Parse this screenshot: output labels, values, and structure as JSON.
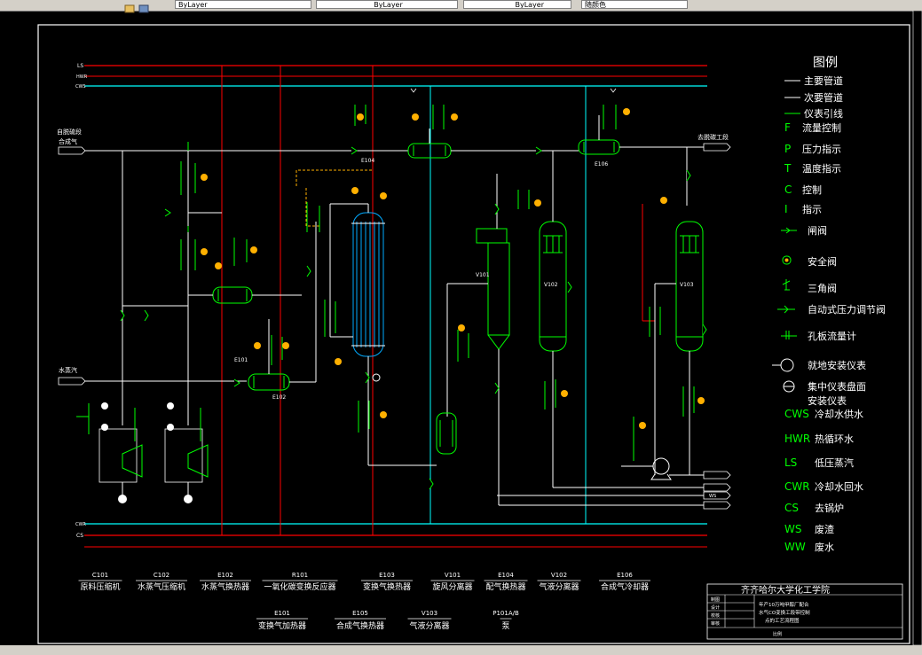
{
  "toolbar": {
    "layer_color": "ByLayer",
    "linetype": "ByLayer",
    "lineweight": "ByLayer",
    "plot_style": "随颜色"
  },
  "drawing": {
    "pipe_labels": {
      "ls": "LS",
      "hwr": "HWR",
      "cws": "CWS",
      "cwr": "CWR",
      "cs": "CS"
    },
    "inlets": {
      "from_desulfur": "自脱硫段",
      "syngas": "合成气",
      "steam": "水蒸汽"
    },
    "outlet": "去脱碳工段",
    "ws_outlet": "WS",
    "equipment_tags": {
      "E104": "E104",
      "E106": "E106",
      "E101": "E101",
      "E102": "E102",
      "V101": "V101",
      "V102": "V102",
      "V103": "V103"
    },
    "equipment_list_row1": [
      {
        "tag": "C101",
        "name": "原料压缩机"
      },
      {
        "tag": "C102",
        "name": "水蒸气压缩机"
      },
      {
        "tag": "E102",
        "name": "水蒸气换热器"
      },
      {
        "tag": "R101",
        "name": "一氧化碳变换反应器"
      },
      {
        "tag": "E103",
        "name": "变换气换热器"
      },
      {
        "tag": "V101",
        "name": "旋风分离器"
      },
      {
        "tag": "E104",
        "name": "配气换热器"
      },
      {
        "tag": "V102",
        "name": "气液分离器"
      },
      {
        "tag": "E106",
        "name": "合成气冷却器"
      }
    ],
    "equipment_list_row2": [
      {
        "tag": "E101",
        "name": "变换气加热器"
      },
      {
        "tag": "E105",
        "name": "合成气换热器"
      },
      {
        "tag": "V103",
        "name": "气液分离器"
      },
      {
        "tag": "P101A/B",
        "name": "泵"
      }
    ],
    "legend": {
      "title": "图例",
      "items": [
        {
          "symbol": "",
          "label": "主要管道",
          "color": "#ffffff"
        },
        {
          "symbol": "",
          "label": "次要管道",
          "color": "#ffffff"
        },
        {
          "symbol": "",
          "label": "仪表引线",
          "color": "#00ff00"
        },
        {
          "symbol": "F",
          "label": "流量控制"
        },
        {
          "symbol": "P",
          "label": "压力指示"
        },
        {
          "symbol": "T",
          "label": "温度指示"
        },
        {
          "symbol": "C",
          "label": "控制"
        },
        {
          "symbol": "I",
          "label": "指示"
        },
        {
          "symbol": "",
          "label": "闸阀"
        },
        {
          "symbol": "",
          "label": "安全阀"
        },
        {
          "symbol": "",
          "label": "三角阀"
        },
        {
          "symbol": "",
          "label": "自动式压力调节阀"
        },
        {
          "symbol": "",
          "label": "孔板流量计"
        },
        {
          "symbol": "",
          "label": "就地安装仪表"
        },
        {
          "symbol": "",
          "label": "集中仪表盘面"
        },
        {
          "symbol": "",
          "label": "安装仪表"
        },
        {
          "symbol": "CWS",
          "label": "冷却水供水"
        },
        {
          "symbol": "HWR",
          "label": "热循环水"
        },
        {
          "symbol": "LS",
          "label": "低压蒸汽"
        },
        {
          "symbol": "CWR",
          "label": "冷却水回水"
        },
        {
          "symbol": "CS",
          "label": "去锅炉"
        },
        {
          "symbol": "WS",
          "label": "废渣"
        },
        {
          "symbol": "WW",
          "label": "废水"
        }
      ]
    },
    "title_block": {
      "school": "齐齐哈尔大学化工学院",
      "roles": [
        "制图",
        "设计",
        "校核",
        "审核"
      ],
      "drawing_title": [
        "年产10万吨甲醇厂配合",
        "水气CO变换工段带控制",
        "点的工艺流程图"
      ],
      "footer": "比例"
    }
  },
  "colors": {
    "background": "#000000",
    "pipe_main": "#ffffff",
    "ls_line": "#ff0000",
    "cws_line": "#00ffff",
    "instrument": "#00ff00",
    "vessel": "#00ff00",
    "reactor_tubes": "#00aaff",
    "indicator": "#ffb000"
  }
}
